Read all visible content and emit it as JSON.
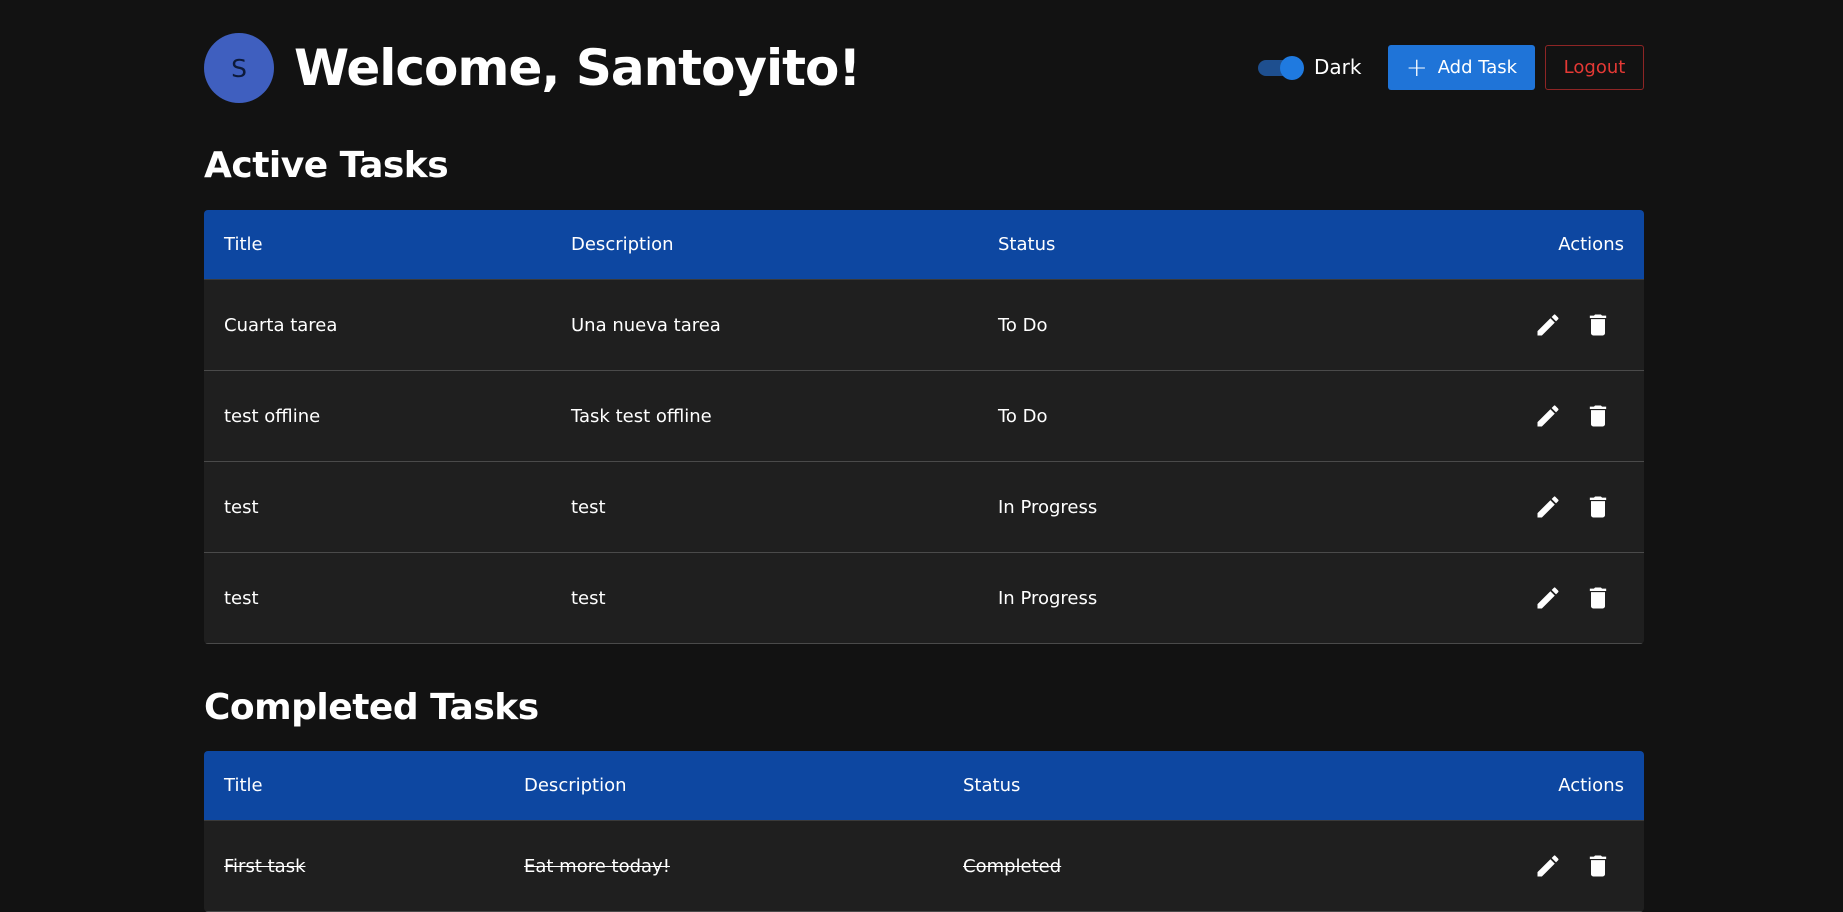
{
  "user": {
    "avatar_letter": "S",
    "welcome": "Welcome, Santoyito!"
  },
  "header": {
    "theme_label": "Dark",
    "theme_toggle_on": true,
    "add_task_label": "Add Task",
    "logout_label": "Logout"
  },
  "colors": {
    "background": "#121212",
    "table_header": "#0d47a1",
    "row_bg": "#1f1f1f",
    "add_button": "#1f74d8",
    "logout": "#e53935",
    "avatar": "#3f5fbf"
  },
  "active": {
    "title": "Active Tasks",
    "headers": {
      "title": "Title",
      "description": "Description",
      "status": "Status",
      "actions": "Actions"
    },
    "rows": [
      {
        "title": "Cuarta tarea",
        "description": "Una nueva tarea",
        "status": "To Do"
      },
      {
        "title": "test offline",
        "description": "Task test offline",
        "status": "To Do"
      },
      {
        "title": "test",
        "description": "test",
        "status": "In Progress"
      },
      {
        "title": "test",
        "description": "test",
        "status": "In Progress"
      }
    ]
  },
  "completed": {
    "title": "Completed Tasks",
    "headers": {
      "title": "Title",
      "description": "Description",
      "status": "Status",
      "actions": "Actions"
    },
    "rows": [
      {
        "title": "First task",
        "description": "Eat more today!",
        "status": "Completed"
      }
    ]
  },
  "icons": {
    "edit": "pencil-icon",
    "delete": "trash-icon",
    "add": "plus-icon"
  }
}
